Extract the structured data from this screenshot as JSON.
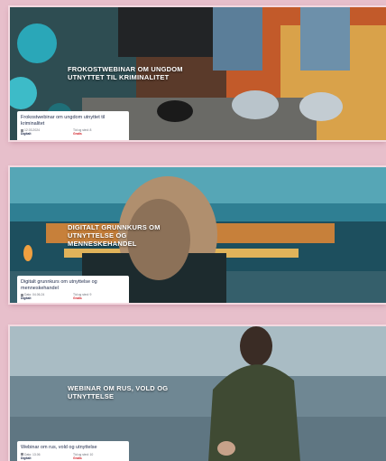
{
  "courses": [
    {
      "hero_title": "FROKOSTWEBINAR OM UNGDOM UTNYTTET TIL KRIMINALITET",
      "card_title": "Frokostwebinar om ungdom utnyttet til kriminalitet",
      "date": "12.03.2024",
      "format": "Digitalt",
      "time": "Tid og sted: 8",
      "price": "Gratis"
    },
    {
      "hero_title": "DIGITALT GRUNNKURS OM UTNYTTELSE OG MENNESKEHANDEL",
      "card_title": "Digitalt grunnkurs om utnyttelse og menneskehandel",
      "date": "Dato: 04.06.24",
      "format": "Digitalt",
      "time": "Tid og sted: 9",
      "price": "Gratis"
    },
    {
      "hero_title": "WEBINAR OM RUS, VOLD OG UTNYTTELSE",
      "card_title": "Webinar om rus, vold og utnyttelse",
      "date": "Dato: 13.06",
      "format": "Digitalt",
      "time": "Tid og sted: 10",
      "price": "Gratis"
    }
  ],
  "colors": {
    "background": "#e7bfcb",
    "card_text": "#1e2a4a",
    "price": "#d2232a"
  }
}
